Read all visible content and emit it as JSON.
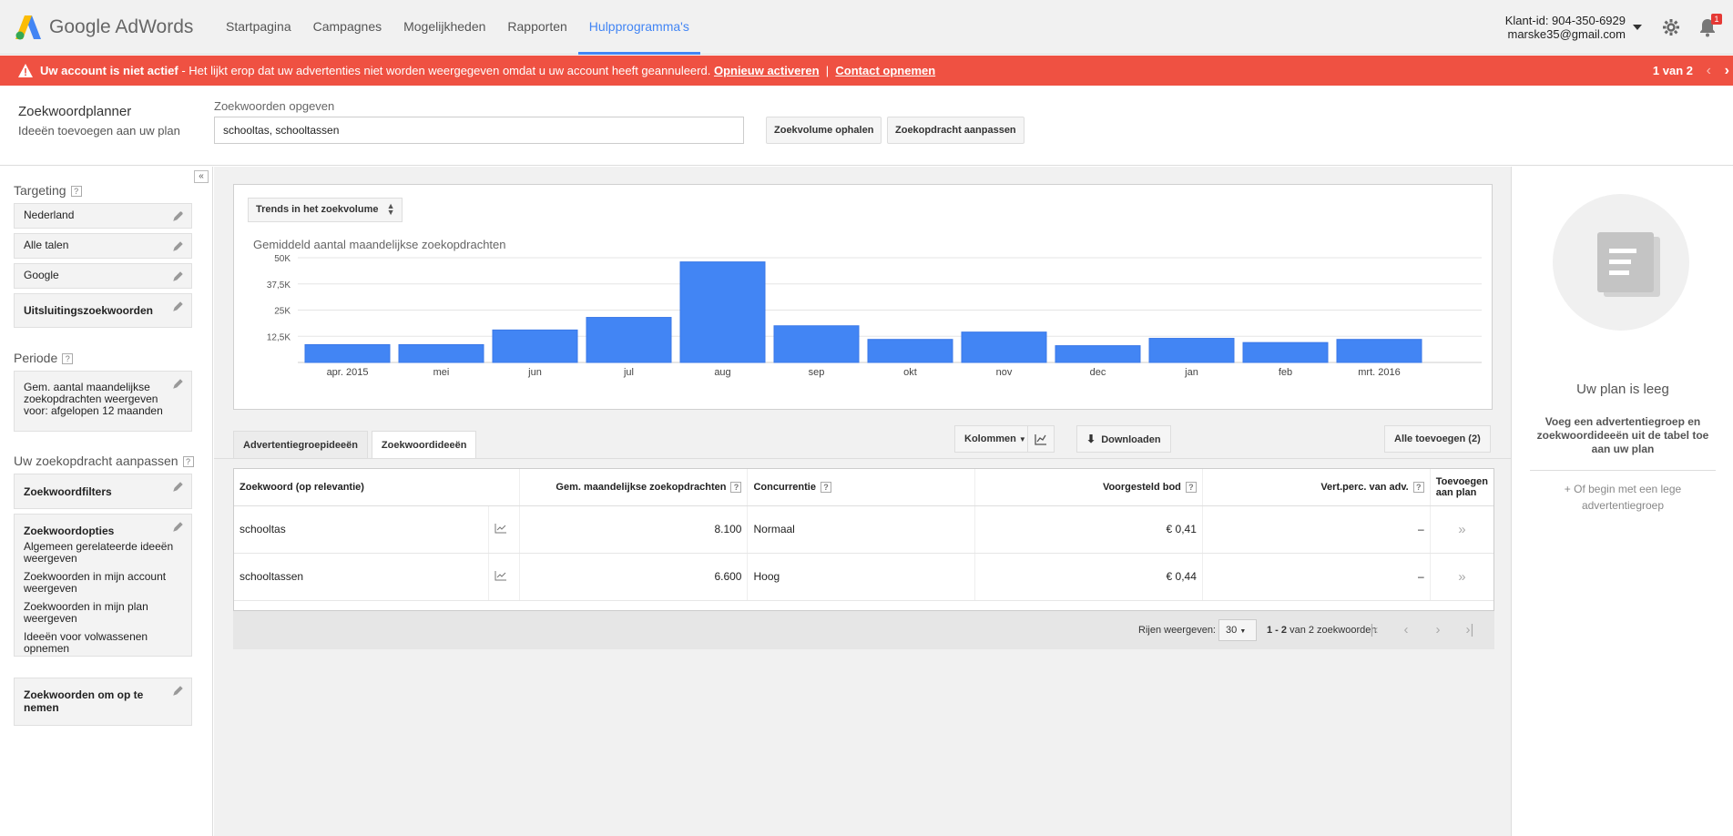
{
  "header": {
    "logo_text": "Google AdWords",
    "nav": [
      {
        "label": "Startpagina"
      },
      {
        "label": "Campagnes"
      },
      {
        "label": "Mogelijkheden"
      },
      {
        "label": "Rapporten"
      },
      {
        "label": "Hulpprogramma's",
        "active": true
      }
    ],
    "customer_id": "Klant-id: 904-350-6929",
    "email": "marske35@gmail.com",
    "notification_count": "1"
  },
  "alert": {
    "bold_text": "Uw account is niet actief",
    "text": " - Het lijkt erop dat uw advertenties niet worden weergegeven omdat u uw account heeft geannuleerd. ",
    "reactivate_link": "Opnieuw activeren",
    "separator": "|",
    "contact_link": "Contact opnemen",
    "pager": "1 van 2",
    "color": "#ef5142"
  },
  "planner": {
    "title": "Zoekwoordplanner",
    "subtitle": "Ideeën toevoegen aan uw plan",
    "keywords_label": "Zoekwoorden opgeven",
    "keywords_value": "schooltas, schooltassen",
    "get_volume_button": "Zoekvolume ophalen",
    "edit_search_button": "Zoekopdracht aanpassen"
  },
  "sidebar": {
    "collapse_label": "«",
    "targeting_label": "Targeting",
    "targeting": [
      "Nederland",
      "Alle talen",
      "Google"
    ],
    "negative_keywords": "Uitsluitingszoekwoorden",
    "period_label": "Periode",
    "period_value": "Gem. aantal maandelijkse zoekopdrachten weergeven voor: afgelopen 12 maanden",
    "adjust_label": "Uw zoekopdracht aanpassen",
    "keyword_filters": "Zoekwoordfilters",
    "keyword_options_title": "Zoekwoordopties",
    "keyword_options": [
      "Algemeen gerelateerde ideeën weergeven",
      "Zoekwoorden in mijn account weergeven",
      "Zoekwoorden in mijn plan weergeven",
      "Ideeën voor volwassenen opnemen"
    ],
    "include_keywords": "Zoekwoorden om op te nemen",
    "help_mark": "?"
  },
  "chart_card": {
    "dropdown_label": "Trends in het zoekvolume",
    "title": "Gemiddeld aantal maandelijkse zoekopdrachten"
  },
  "chart_data": {
    "type": "bar",
    "title": "Gemiddeld aantal maandelijkse zoekopdrachten",
    "categories": [
      "apr. 2015",
      "mei",
      "jun",
      "jul",
      "aug",
      "sep",
      "okt",
      "nov",
      "dec",
      "jan",
      "feb",
      "mrt. 2016"
    ],
    "values": [
      8500,
      8500,
      15500,
      21500,
      48000,
      17500,
      11000,
      14500,
      8000,
      11500,
      9500,
      11000
    ],
    "ylim": [
      0,
      50000
    ],
    "yticks": [
      12500,
      25000,
      37500,
      50000
    ],
    "ytick_labels": [
      "12,5K",
      "25K",
      "37,5K",
      "50K"
    ],
    "bar_color": "#4285f4",
    "grid": true
  },
  "tabs": [
    {
      "label": "Advertentiegroepideeën"
    },
    {
      "label": "Zoekwoordideeën",
      "active": true
    }
  ],
  "toolbar": {
    "columns_button": "Kolommen",
    "download_button": "Downloaden",
    "add_all_button": "Alle toevoegen (2)"
  },
  "table": {
    "headers": {
      "keyword": "Zoekwoord (op relevantie)",
      "searches": "Gem. maandelijkse zoekopdrachten",
      "competition": "Concurrentie",
      "bid": "Voorgesteld bod",
      "share": "Vert.perc. van adv.",
      "add_line1": "Toevoegen",
      "add_line2": "aan plan"
    },
    "rows": [
      {
        "keyword": "schooltas",
        "searches": "8.100",
        "competition": "Normaal",
        "bid": "€ 0,41",
        "share": "–",
        "add": "»"
      },
      {
        "keyword": "schooltassen",
        "searches": "6.600",
        "competition": "Hoog",
        "bid": "€ 0,44",
        "share": "–",
        "add": "»"
      }
    ]
  },
  "pagination": {
    "rows_label": "Rijen weergeven:",
    "rows_value": "30",
    "range_bold": "1 - 2",
    "range_rest": " van 2 zoekwoorden"
  },
  "plan": {
    "title": "Uw plan is leeg",
    "description": "Voeg een advertentiegroep en zoekwoordideeën uit de tabel toe aan uw plan",
    "empty_group_link": "+ Of begin met een lege advertentiegroep"
  }
}
